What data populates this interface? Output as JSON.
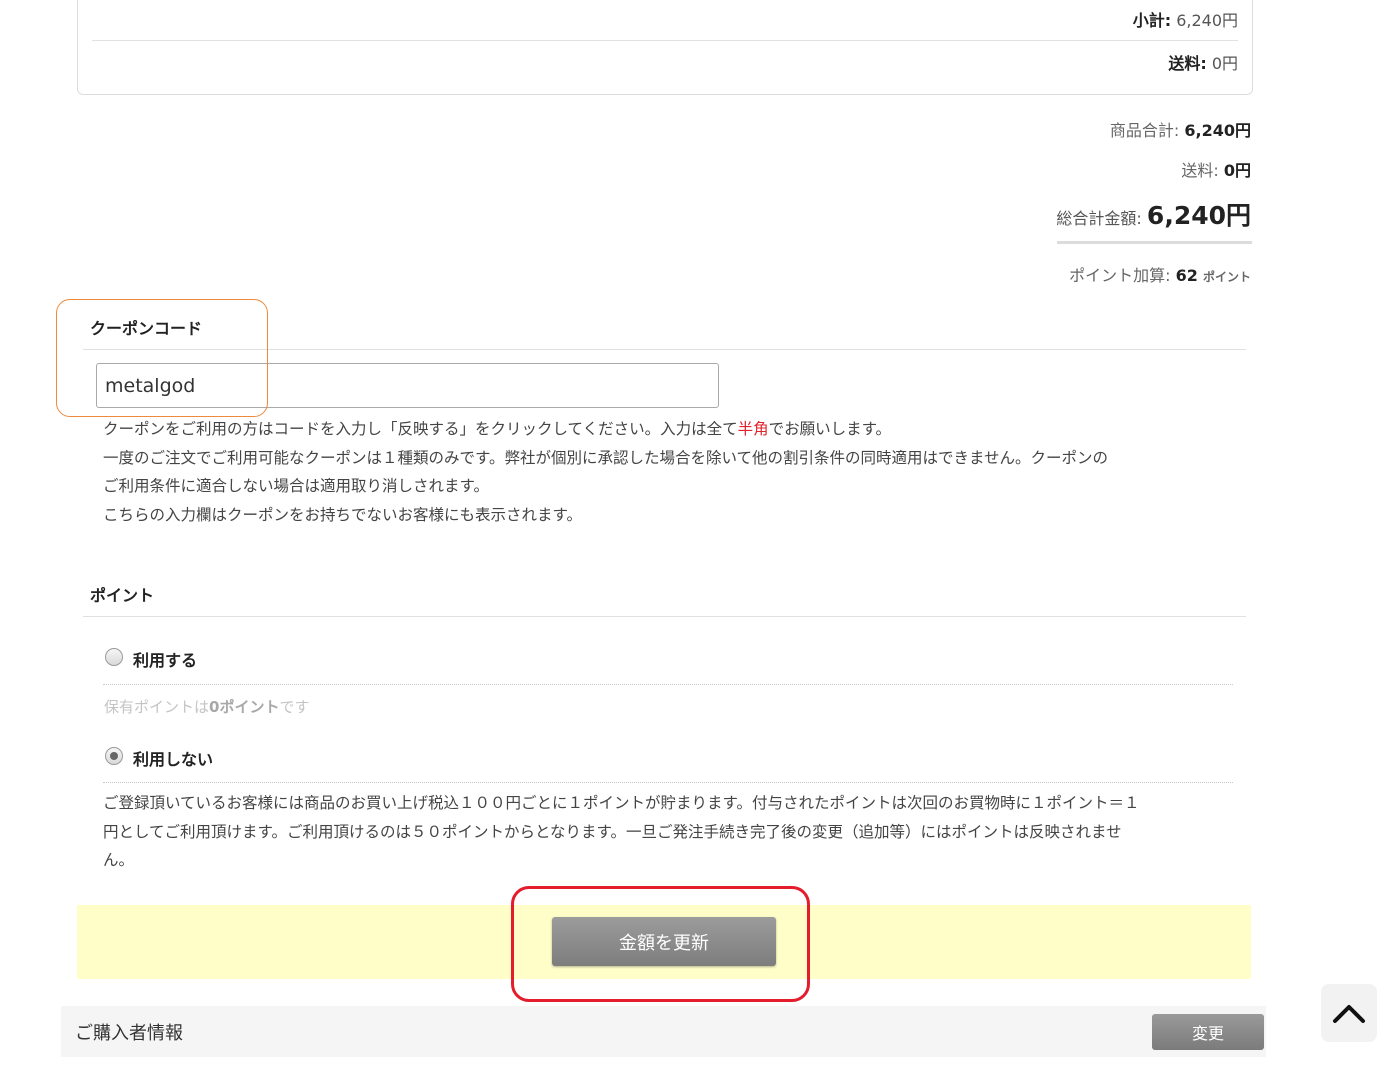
{
  "summary_card": {
    "subtotal_label": "小計:",
    "subtotal_value": "6,240円",
    "shipping_label": "送料:",
    "shipping_value": "0円"
  },
  "totals": {
    "product_total_label": "商品合計:",
    "product_total_value": "6,240円",
    "shipping_label": "送料:",
    "shipping_value": "0円",
    "grand_total_label": "総合計金額:",
    "grand_total_value": "6,240円",
    "points_earned_label": "ポイント加算:",
    "points_earned_value": "62",
    "points_unit": "ポイント"
  },
  "coupon": {
    "title": "クーポンコード",
    "input_value": "metalgod",
    "note_line1_a": "クーポンをご利用の方はコードを入力し「反映する」をクリックしてください。入力は全て",
    "note_line1_red": "半角",
    "note_line1_b": "でお願いします。",
    "note_line2": "一度のご注文でご利用可能なクーポンは１種類のみです。弊社が個別に承認した場合を除いて他の割引条件の同時適用はできません。クーポンの",
    "note_line3": "ご利用条件に適合しない場合は適用取り消しされます。",
    "note_line4": "こちらの入力欄はクーポンをお持ちでないお客様にも表示されます。"
  },
  "points": {
    "title": "ポイント",
    "option_use_label": "利用する",
    "held_prefix": "保有ポイントは",
    "held_value": "0ポイント",
    "held_suffix": "です",
    "option_not_use_label": "利用しない",
    "selected": "利用しない",
    "note_line1": "ご登録頂いているお客様には商品のお買い上げ税込１００円ごとに１ポイントが貯まります。付与されたポイントは次回のお買物時に１ポイント＝１",
    "note_line2": "円としてご利用頂けます。ご利用頂けるのは５０ポイントからとなります。一旦ご発注手続き完了後の変更（追加等）にはポイントは反映されませ",
    "note_line3": "ん。"
  },
  "update_button_label": "金額を更新",
  "buyer_info": {
    "title": "ご購入者情報",
    "change_button_label": "変更"
  },
  "icons": {
    "back_to_top": "chevron-up-icon"
  },
  "colors": {
    "highlight_red": "#e41c2b",
    "highlight_orange": "#ef8a3c",
    "update_area_bg": "#fffec9"
  }
}
